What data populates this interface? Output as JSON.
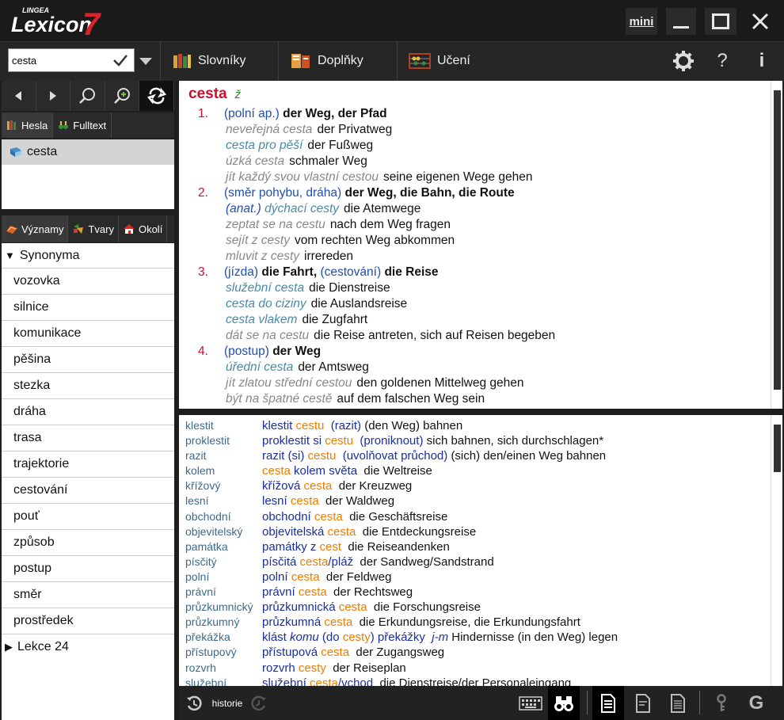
{
  "app": {
    "brand": "LINGEA",
    "name": "Lexicon",
    "version": "7"
  },
  "window": {
    "mini_label": "mini"
  },
  "search": {
    "value": "cesta",
    "placeholder": ""
  },
  "toolbar": {
    "tabs": [
      {
        "label": "Slovníky"
      },
      {
        "label": "Doplňky"
      },
      {
        "label": "Učení"
      }
    ]
  },
  "left": {
    "subtabs": [
      {
        "label": "Hesla"
      },
      {
        "label": "Fulltext"
      }
    ],
    "headwords": [
      "cesta"
    ],
    "meaning_tabs": [
      {
        "label": "Významy"
      },
      {
        "label": "Tvary"
      },
      {
        "label": "Okolí"
      }
    ],
    "synonyms_header": "Synonyma",
    "synonyms": [
      "vozovka",
      "silnice",
      "komunikace",
      "pěšina",
      "stezka",
      "dráha",
      "trasa",
      "trajektorie",
      "cestování",
      "pouť",
      "způsob",
      "postup",
      "směr",
      "prostředek"
    ],
    "lesson": "Lekce 24"
  },
  "entry": {
    "headword": "cesta",
    "gender": "ž",
    "senses": [
      {
        "num": "1.",
        "note": "(polní ap.)",
        "de": "der Weg, der Pfad",
        "examples": [
          [
            "neveřejná cesta",
            "der Privatweg",
            "i"
          ],
          [
            "cesta pro pěší",
            "der Fußweg",
            "c"
          ],
          [
            "úzká cesta",
            "schmaler Weg",
            "i"
          ],
          [
            "jít každý svou vlastní cestou",
            "seine eigenen Wege gehen",
            "i"
          ]
        ]
      },
      {
        "num": "2.",
        "note": "(směr pohybu, dráha)",
        "de": "der Weg, die Bahn, die Route",
        "examples": [
          [
            "(anat.) dýchací cesty",
            "die Atemwege",
            "c"
          ],
          [
            "zeptat se na cestu",
            "nach dem Weg fragen",
            "i"
          ],
          [
            "sejít z cesty",
            "vom rechten Weg abkommen",
            "i"
          ],
          [
            "mluvit z cesty",
            "irrereden",
            "i"
          ]
        ]
      },
      {
        "num": "3.",
        "note": "(jízda)",
        "de": "die Fahrt,",
        "note2": "(cestování)",
        "de2": "die Reise",
        "examples": [
          [
            "služební cesta",
            "die Dienstreise",
            "c"
          ],
          [
            "cesta do ciziny",
            "die Auslandsreise",
            "c"
          ],
          [
            "cesta vlakem",
            "die Zugfahrt",
            "c"
          ],
          [
            "dát se na cestu",
            "die Reise antreten, sich auf Reisen begeben",
            "i"
          ]
        ]
      },
      {
        "num": "4.",
        "note": "(postup)",
        "de": "der Weg",
        "examples": [
          [
            "úřední cesta",
            "der Amtsweg",
            "c"
          ],
          [
            "jít zlatou střední cestou",
            "den goldenen Mittelweg gehen",
            "i"
          ],
          [
            "být na špatné cestě",
            "auf dem falschen Weg sein",
            "i"
          ]
        ]
      }
    ]
  },
  "fulltext": [
    {
      "key": "klestit",
      "parts": [
        [
          "v",
          "klestit "
        ],
        [
          "o",
          "cestu"
        ],
        [
          "v",
          "  (razit) "
        ],
        [
          "b",
          "(den Weg) bahnen"
        ]
      ]
    },
    {
      "key": "proklestit",
      "parts": [
        [
          "v",
          "proklestit si "
        ],
        [
          "o",
          "cestu"
        ],
        [
          "v",
          "  (proniknout) "
        ],
        [
          "b",
          "sich bahnen, sich durchschlagen*"
        ]
      ]
    },
    {
      "key": "razit",
      "parts": [
        [
          "v",
          "razit (si) "
        ],
        [
          "o",
          "cestu"
        ],
        [
          "v",
          "  (uvolňovat průchod) "
        ],
        [
          "b",
          "(sich) den/einen Weg bahnen"
        ]
      ]
    },
    {
      "key": "kolem",
      "parts": [
        [
          "o",
          "cesta "
        ],
        [
          "v",
          "kolem světa"
        ],
        [
          "b",
          "  die Weltreise"
        ]
      ]
    },
    {
      "key": "křížový",
      "parts": [
        [
          "v",
          "křížová "
        ],
        [
          "o",
          "cesta"
        ],
        [
          "b",
          "  der Kreuzweg"
        ]
      ]
    },
    {
      "key": "lesní",
      "parts": [
        [
          "v",
          "lesní "
        ],
        [
          "o",
          "cesta"
        ],
        [
          "b",
          "  der Waldweg"
        ]
      ]
    },
    {
      "key": "obchodní",
      "parts": [
        [
          "v",
          "obchodní "
        ],
        [
          "o",
          "cesta"
        ],
        [
          "b",
          "  die Geschäftsreise"
        ]
      ]
    },
    {
      "key": "objevitelský",
      "parts": [
        [
          "v",
          "objevitelská "
        ],
        [
          "o",
          "cesta"
        ],
        [
          "b",
          "  die Entdeckungsreise"
        ]
      ]
    },
    {
      "key": "památka",
      "parts": [
        [
          "v",
          "památky z "
        ],
        [
          "o",
          "cest"
        ],
        [
          "b",
          "  die Reiseandenken"
        ]
      ]
    },
    {
      "key": "písčitý",
      "parts": [
        [
          "v",
          "písčitá "
        ],
        [
          "o",
          "cesta"
        ],
        [
          "v",
          "/pláž"
        ],
        [
          "b",
          "  der Sandweg/Sandstrand"
        ]
      ]
    },
    {
      "key": "polní",
      "parts": [
        [
          "v",
          "polní "
        ],
        [
          "o",
          "cesta"
        ],
        [
          "b",
          "  der Feldweg"
        ]
      ]
    },
    {
      "key": "právní",
      "parts": [
        [
          "v",
          "právní "
        ],
        [
          "o",
          "cesta"
        ],
        [
          "b",
          "  der Rechtsweg"
        ]
      ]
    },
    {
      "key": "průzkumnický",
      "parts": [
        [
          "v",
          "průzkumnická "
        ],
        [
          "o",
          "cesta"
        ],
        [
          "b",
          "  die Forschungsreise"
        ]
      ]
    },
    {
      "key": "průzkumný",
      "parts": [
        [
          "v",
          "průzkumná "
        ],
        [
          "o",
          "cesta"
        ],
        [
          "b",
          "  die Erkundungsreise, die Erkundungsfahrt"
        ]
      ]
    },
    {
      "key": "překážka",
      "parts": [
        [
          "v",
          "klást "
        ],
        [
          "vi",
          "komu"
        ],
        [
          "v",
          " (do "
        ],
        [
          "o",
          "cesty"
        ],
        [
          "v",
          ") překážky  "
        ],
        [
          "vi",
          "j-m"
        ],
        [
          "b",
          " Hindernisse (in den Weg) legen"
        ]
      ]
    },
    {
      "key": "přístupový",
      "parts": [
        [
          "v",
          "přístupová "
        ],
        [
          "o",
          "cesta"
        ],
        [
          "b",
          "  der Zugangsweg"
        ]
      ]
    },
    {
      "key": "rozvrh",
      "parts": [
        [
          "v",
          "rozvrh "
        ],
        [
          "o",
          "cesty"
        ],
        [
          "b",
          "  der Reiseplan"
        ]
      ]
    },
    {
      "key": "služební",
      "parts": [
        [
          "v",
          "služební "
        ],
        [
          "o",
          "cesta"
        ],
        [
          "v",
          "/vchod"
        ],
        [
          "b",
          "  die Dienstreise/der Personaleingang"
        ]
      ]
    }
  ],
  "bottom": {
    "history_label": "historie"
  },
  "colors": {
    "headword": "#c8102e",
    "accent": "#ef7d00",
    "link": "#1a2fa0"
  }
}
